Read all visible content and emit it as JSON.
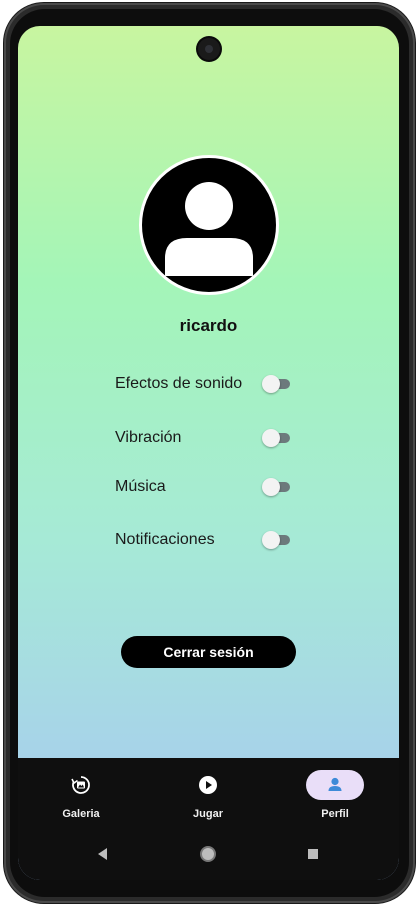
{
  "profile": {
    "username": "ricardo"
  },
  "settings": {
    "items": [
      {
        "label": "Efectos de sonido",
        "enabled": false
      },
      {
        "label": "Vibración",
        "enabled": false
      },
      {
        "label": "Música",
        "enabled": false
      },
      {
        "label": "Notificaciones",
        "enabled": false
      }
    ]
  },
  "actions": {
    "logout_label": "Cerrar sesión"
  },
  "bottom_nav": {
    "items": [
      {
        "label": "Galeria",
        "icon": "gallery-icon",
        "active": false
      },
      {
        "label": "Jugar",
        "icon": "play-icon",
        "active": false
      },
      {
        "label": "Perfil",
        "icon": "person-icon",
        "active": true
      }
    ]
  },
  "system_nav": {
    "buttons": [
      "back-icon",
      "home-icon",
      "recents-icon"
    ]
  },
  "colors": {
    "gradient_top": "#c8f5a0",
    "gradient_bottom": "#a8c6f4",
    "nav_background": "#0f0f0f",
    "active_pill": "#e9def8",
    "active_icon": "#3d8ad8"
  }
}
